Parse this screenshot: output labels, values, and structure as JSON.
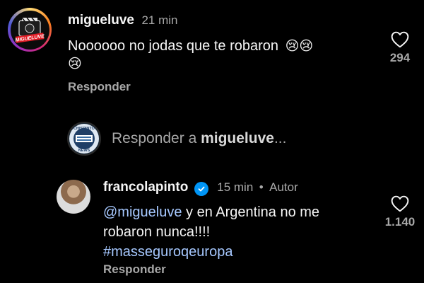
{
  "comments": [
    {
      "username": "migueluve",
      "time": "21 min",
      "text": "Noooooo no jodas que te robaron",
      "emoji_line1": "😢😢",
      "emoji_line2": "😢",
      "reply_label": "Responder",
      "likes": "294",
      "avatar_label": "MIGUELUVE",
      "avatar_ring_colors": [
        "#feda75",
        "#fa7e1e",
        "#d62976",
        "#962fbf",
        "#4f5bd5"
      ]
    },
    {
      "username": "francolapinto",
      "time": "15 min",
      "separator": "•",
      "author_label": "Autor",
      "mention": "@migueluve",
      "text_after_mention": " y en Argentina no me",
      "text_line2": "robaron nunca!!!!",
      "hashtag": "#masseguroqeuropa",
      "reply_label": "Responder",
      "likes": "1.140",
      "verified": true
    }
  ],
  "reply_box": {
    "prefix": "Responder a",
    "username": "migueluve",
    "suffix": "...",
    "avatar_top": "CHISPINTO",
    "avatar_bottom": "NEWS"
  },
  "colors": {
    "background": "#000000",
    "text": "#f5f5f5",
    "muted": "#a8a8a8",
    "link": "#a6c8ff",
    "verified": "#0095f6"
  }
}
